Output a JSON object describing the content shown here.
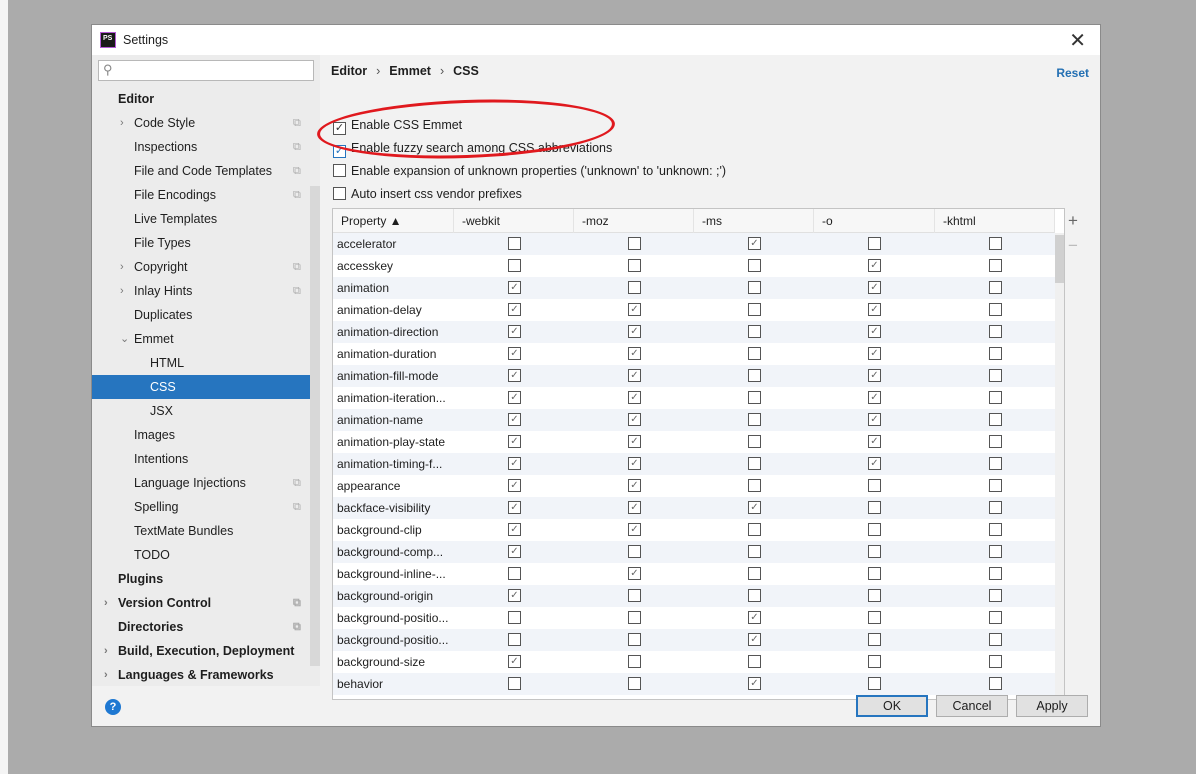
{
  "window": {
    "title": "Settings",
    "close": "✕"
  },
  "search": {
    "placeholder": "",
    "icon": "search-icon"
  },
  "sidebar": [
    {
      "label": "Editor",
      "level": 0,
      "bold": true
    },
    {
      "label": "Code Style",
      "level": 1,
      "arrow": "›",
      "copy": true
    },
    {
      "label": "Inspections",
      "level": 1,
      "copy": true
    },
    {
      "label": "File and Code Templates",
      "level": 1,
      "copy": true
    },
    {
      "label": "File Encodings",
      "level": 1,
      "copy": true
    },
    {
      "label": "Live Templates",
      "level": 1
    },
    {
      "label": "File Types",
      "level": 1
    },
    {
      "label": "Copyright",
      "level": 1,
      "arrow": "›",
      "copy": true
    },
    {
      "label": "Inlay Hints",
      "level": 1,
      "arrow": "›",
      "copy": true
    },
    {
      "label": "Duplicates",
      "level": 1
    },
    {
      "label": "Emmet",
      "level": 1,
      "arrow": "⌄"
    },
    {
      "label": "HTML",
      "level": 2
    },
    {
      "label": "CSS",
      "level": 2,
      "selected": true
    },
    {
      "label": "JSX",
      "level": 2
    },
    {
      "label": "Images",
      "level": 1
    },
    {
      "label": "Intentions",
      "level": 1
    },
    {
      "label": "Language Injections",
      "level": 1,
      "copy": true
    },
    {
      "label": "Spelling",
      "level": 1,
      "copy": true
    },
    {
      "label": "TextMate Bundles",
      "level": 1
    },
    {
      "label": "TODO",
      "level": 1
    },
    {
      "label": "Plugins",
      "level": 0,
      "bold": true
    },
    {
      "label": "Version Control",
      "level": 0,
      "bold": true,
      "arrow": "›",
      "copy": true
    },
    {
      "label": "Directories",
      "level": 0,
      "bold": true,
      "copy": true
    },
    {
      "label": "Build, Execution, Deployment",
      "level": 0,
      "bold": true,
      "arrow": "›"
    },
    {
      "label": "Languages & Frameworks",
      "level": 0,
      "bold": true,
      "arrow": "›"
    }
  ],
  "breadcrumb": [
    "Editor",
    "Emmet",
    "CSS"
  ],
  "reset_label": "Reset",
  "options": [
    {
      "label": "Enable CSS Emmet",
      "checked": true
    },
    {
      "label": "Enable fuzzy search among CSS abbreviations",
      "checked": true
    },
    {
      "label": "Enable expansion of unknown properties ('unknown' to 'unknown: ;')",
      "checked": false
    },
    {
      "label": "Auto insert css vendor prefixes",
      "checked": false
    }
  ],
  "table": {
    "columns": [
      "Property ▲",
      "-webkit",
      "-moz",
      "-ms",
      "-o",
      "-khtml"
    ],
    "rows": [
      {
        "name": "accelerator",
        "v": [
          0,
          0,
          1,
          0,
          0
        ]
      },
      {
        "name": "accesskey",
        "v": [
          0,
          0,
          0,
          1,
          0
        ]
      },
      {
        "name": "animation",
        "v": [
          1,
          0,
          0,
          1,
          0
        ]
      },
      {
        "name": "animation-delay",
        "v": [
          1,
          1,
          0,
          1,
          0
        ]
      },
      {
        "name": "animation-direction",
        "v": [
          1,
          1,
          0,
          1,
          0
        ]
      },
      {
        "name": "animation-duration",
        "v": [
          1,
          1,
          0,
          1,
          0
        ]
      },
      {
        "name": "animation-fill-mode",
        "v": [
          1,
          1,
          0,
          1,
          0
        ]
      },
      {
        "name": "animation-iteration...",
        "v": [
          1,
          1,
          0,
          1,
          0
        ]
      },
      {
        "name": "animation-name",
        "v": [
          1,
          1,
          0,
          1,
          0
        ]
      },
      {
        "name": "animation-play-state",
        "v": [
          1,
          1,
          0,
          1,
          0
        ]
      },
      {
        "name": "animation-timing-f...",
        "v": [
          1,
          1,
          0,
          1,
          0
        ]
      },
      {
        "name": "appearance",
        "v": [
          1,
          1,
          0,
          0,
          0
        ]
      },
      {
        "name": "backface-visibility",
        "v": [
          1,
          1,
          1,
          0,
          0
        ]
      },
      {
        "name": "background-clip",
        "v": [
          1,
          1,
          0,
          0,
          0
        ]
      },
      {
        "name": "background-comp...",
        "v": [
          1,
          0,
          0,
          0,
          0
        ]
      },
      {
        "name": "background-inline-...",
        "v": [
          0,
          1,
          0,
          0,
          0
        ]
      },
      {
        "name": "background-origin",
        "v": [
          1,
          0,
          0,
          0,
          0
        ]
      },
      {
        "name": "background-positio...",
        "v": [
          0,
          0,
          1,
          0,
          0
        ]
      },
      {
        "name": "background-positio...",
        "v": [
          0,
          0,
          1,
          0,
          0
        ]
      },
      {
        "name": "background-size",
        "v": [
          1,
          0,
          0,
          0,
          0
        ]
      },
      {
        "name": "behavior",
        "v": [
          0,
          0,
          1,
          0,
          0
        ]
      }
    ],
    "add": "+",
    "remove": "−"
  },
  "buttons": {
    "ok": "OK",
    "cancel": "Cancel",
    "apply": "Apply",
    "help": "?"
  },
  "colors": {
    "accent": "#2675bf",
    "annotation": "#e0191e"
  }
}
